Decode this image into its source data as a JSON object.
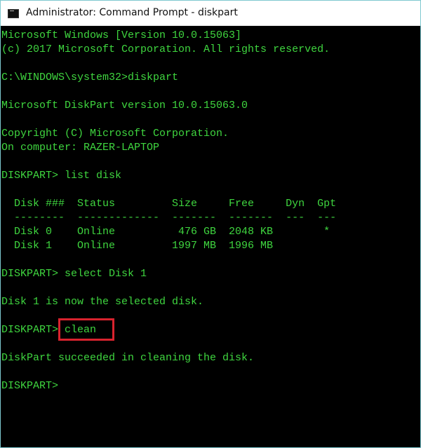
{
  "window": {
    "title": "Administrator: Command Prompt - diskpart",
    "icon": "command-prompt-icon"
  },
  "console": {
    "text_color": "#3fd63f",
    "background_color": "#000000",
    "lines": {
      "version": "Microsoft Windows [Version 10.0.15063]",
      "copyright": "(c) 2017 Microsoft Corporation. All rights reserved.",
      "cmd_diskpart": "C:\\WINDOWS\\system32>diskpart",
      "diskpart_version": "Microsoft DiskPart version 10.0.15063.0",
      "diskpart_copyright": "Copyright (C) Microsoft Corporation.",
      "computer": "On computer: RAZER-LAPTOP",
      "cmd_list_disk": "DISKPART> list disk",
      "select_result": "Disk 1 is now the selected disk.",
      "cmd_select": "DISKPART> select Disk 1",
      "clean_prompt": "DISKPART> ",
      "clean_command": "clean",
      "clean_result": "DiskPart succeeded in cleaning the disk.",
      "final_prompt": "DISKPART>"
    },
    "disk_table": {
      "header": "  Disk ###  Status         Size     Free     Dyn  Gpt",
      "separator": "  --------  -------------  -------  -------  ---  ---",
      "columns": [
        "Disk ###",
        "Status",
        "Size",
        "Free",
        "Dyn",
        "Gpt"
      ],
      "rows": [
        {
          "disk": "Disk 0",
          "status": "Online",
          "size": "476 GB",
          "free": "2048 KB",
          "dyn": "",
          "gpt": "*",
          "text": "  Disk 0    Online          476 GB  2048 KB        *"
        },
        {
          "disk": "Disk 1",
          "status": "Online",
          "size": "1997 MB",
          "free": "1996 MB",
          "dyn": "",
          "gpt": "",
          "text": "  Disk 1    Online         1997 MB  1996 MB"
        }
      ]
    },
    "highlight": {
      "target": "clean",
      "color": "#d9232e"
    }
  }
}
